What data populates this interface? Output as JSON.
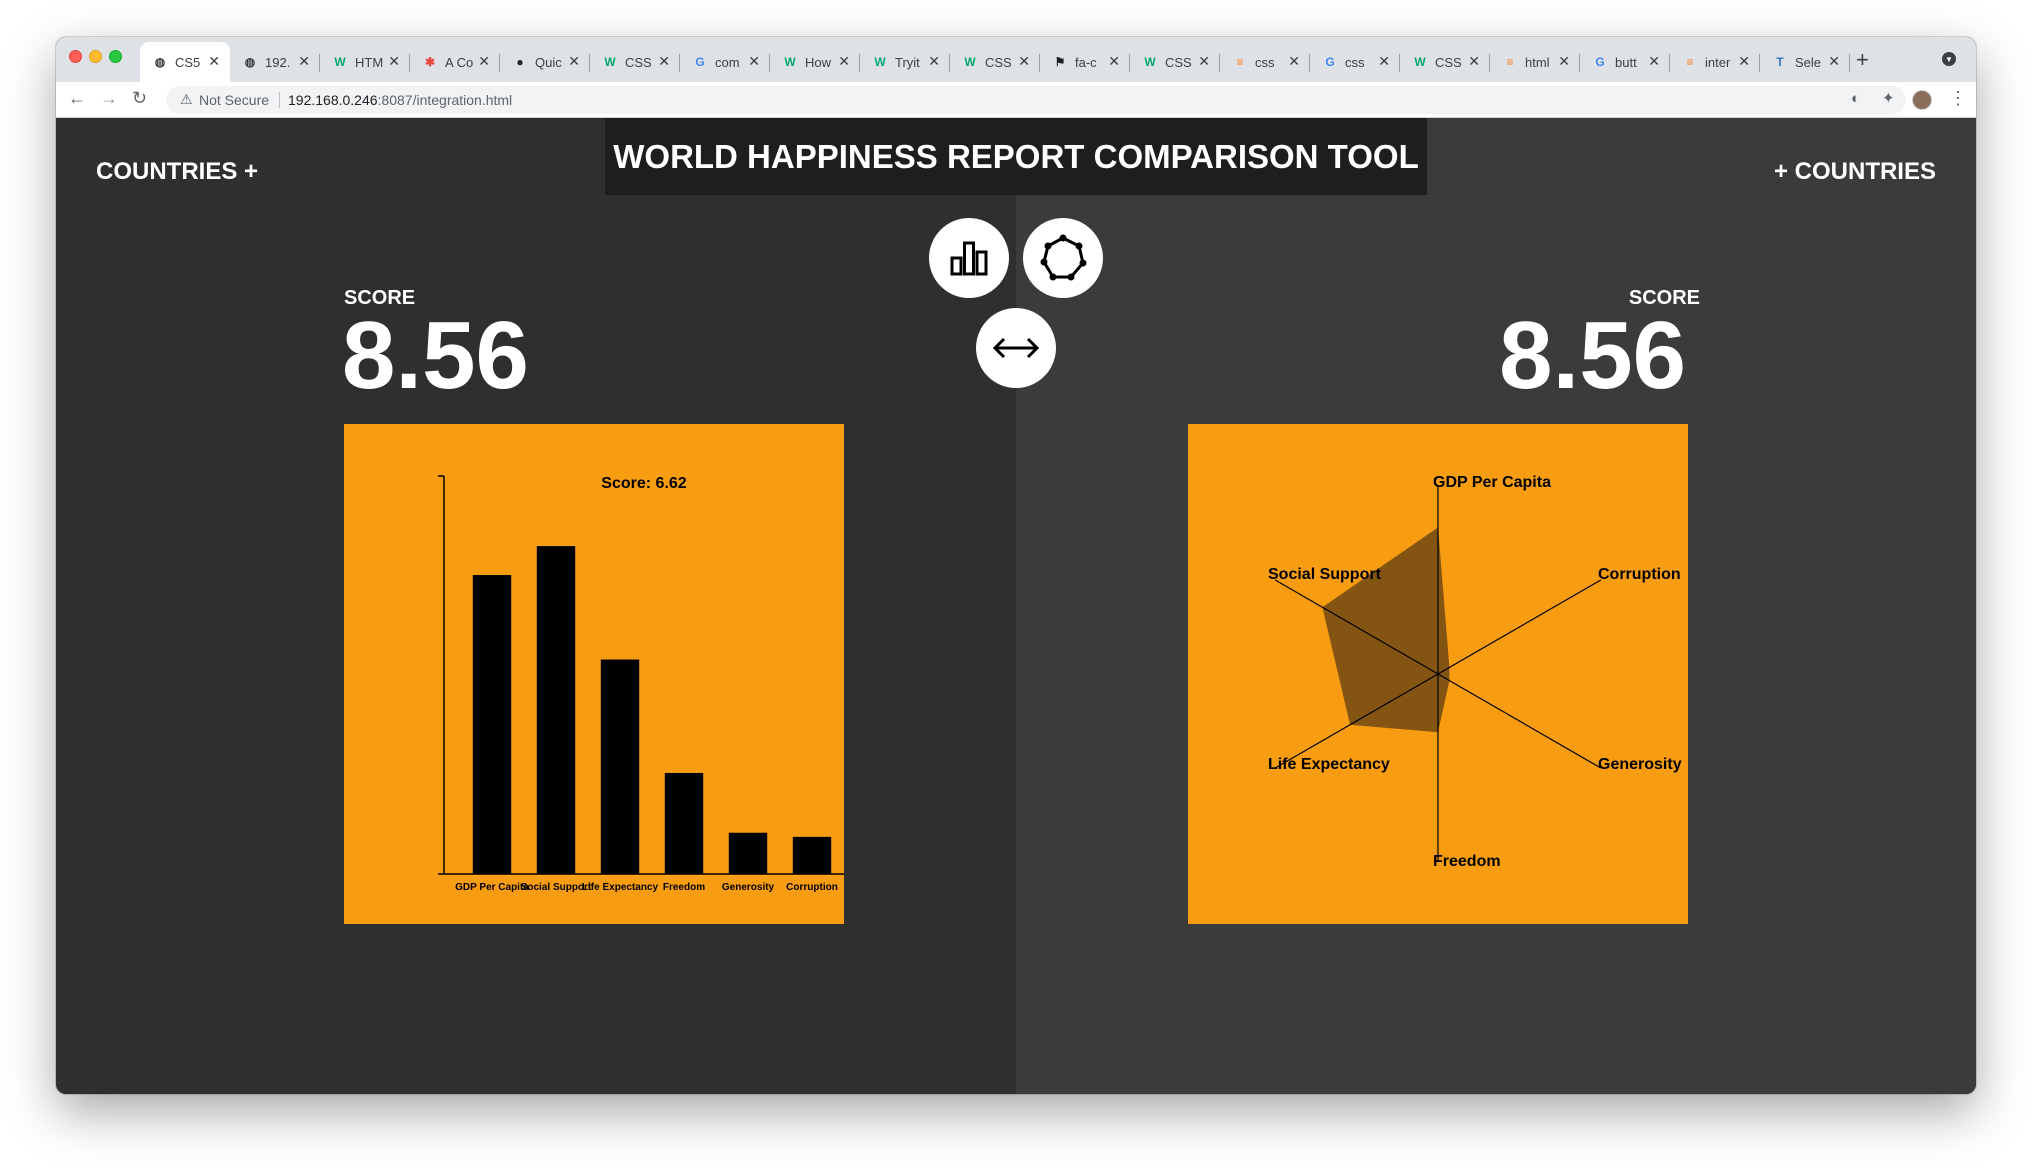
{
  "browser": {
    "tabs": [
      {
        "title": "CS5",
        "icon": "globe-icon",
        "active": true
      },
      {
        "title": "192.",
        "icon": "globe-icon"
      },
      {
        "title": "HTM",
        "icon": "w3schools-icon"
      },
      {
        "title": "A Co",
        "icon": "asterisk-icon"
      },
      {
        "title": "Quic",
        "icon": "circle-logo-icon"
      },
      {
        "title": "CSS",
        "icon": "w3schools-icon"
      },
      {
        "title": "com",
        "icon": "google-icon"
      },
      {
        "title": "How",
        "icon": "w3schools-icon"
      },
      {
        "title": "Tryit",
        "icon": "w3schools-icon"
      },
      {
        "title": "CSS",
        "icon": "w3schools-icon"
      },
      {
        "title": "fa-c",
        "icon": "fontawesome-icon"
      },
      {
        "title": "CSS",
        "icon": "w3schools-icon"
      },
      {
        "title": "css",
        "icon": "stackoverflow-icon"
      },
      {
        "title": "css",
        "icon": "google-icon"
      },
      {
        "title": "CSS",
        "icon": "w3schools-icon"
      },
      {
        "title": "html",
        "icon": "stackoverflow-icon"
      },
      {
        "title": "butt",
        "icon": "google-icon"
      },
      {
        "title": "inter",
        "icon": "stackoverflow-icon"
      },
      {
        "title": "Sele",
        "icon": "typescript-icon"
      }
    ],
    "not_secure": "Not Secure",
    "url_host": "192.168.0.246",
    "url_rest": ":8087/integration.html"
  },
  "page": {
    "title": "WORLD HAPPINESS REPORT COMPARISON TOOL",
    "countries_left": "COUNTRIES +",
    "countries_right": "+ COUNTRIES",
    "buttons": {
      "bar_chart": "bar-chart-icon",
      "radar_chart": "radar-chart-icon",
      "swap": "swap-arrows-icon"
    },
    "left": {
      "score_label": "SCORE",
      "score_value": "8.56"
    },
    "right": {
      "score_label": "SCORE",
      "score_value": "8.56"
    },
    "colors": {
      "chart_bg": "#f89c12",
      "left_bg": "#2f2f2f",
      "right_bg": "#3b3b3b"
    }
  },
  "chart_data": [
    {
      "type": "bar",
      "title": "Score: 6.62",
      "categories": [
        "GDP Per Capita",
        "Social Support",
        "Life Expectancy",
        "Freedom",
        "Generosity",
        "Corruption"
      ],
      "values": [
        1.45,
        1.59,
        1.04,
        0.49,
        0.2,
        0.18
      ],
      "ylim": [
        0,
        1.93
      ],
      "xlabel": "",
      "ylabel": ""
    },
    {
      "type": "radar",
      "axes": [
        "GDP Per Capita",
        "Corruption",
        "Generosity",
        "Freedom",
        "Life Expectancy",
        "Social Support"
      ],
      "values": [
        0.78,
        0.07,
        0.07,
        0.31,
        0.54,
        0.71
      ],
      "range": [
        0,
        1
      ]
    }
  ]
}
